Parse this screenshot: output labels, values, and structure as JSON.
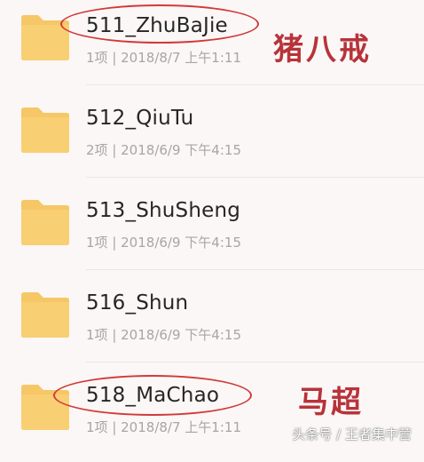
{
  "files": [
    {
      "name": "511_ZhuBaJie",
      "count": "1项",
      "date": "2018/8/7",
      "time": "上午1:11"
    },
    {
      "name": "512_QiuTu",
      "count": "2项",
      "date": "2018/6/9",
      "time": "下午4:15"
    },
    {
      "name": "513_ShuSheng",
      "count": "1项",
      "date": "2018/6/9",
      "time": "下午4:15"
    },
    {
      "name": "516_Shun",
      "count": "1项",
      "date": "2018/6/9",
      "time": "下午4:15"
    },
    {
      "name": "518_MaChao",
      "count": "1项",
      "date": "2018/8/7",
      "time": "上午1:11"
    }
  ],
  "annotations": {
    "first": "猪八戒",
    "last": "马超"
  },
  "watermark": "头条号 / 王者集中营",
  "icons": {
    "folder": "folder-icon"
  },
  "colors": {
    "folder": "#f6c766",
    "annotation": "#b7333a",
    "ellipse": "#d13a3a"
  }
}
